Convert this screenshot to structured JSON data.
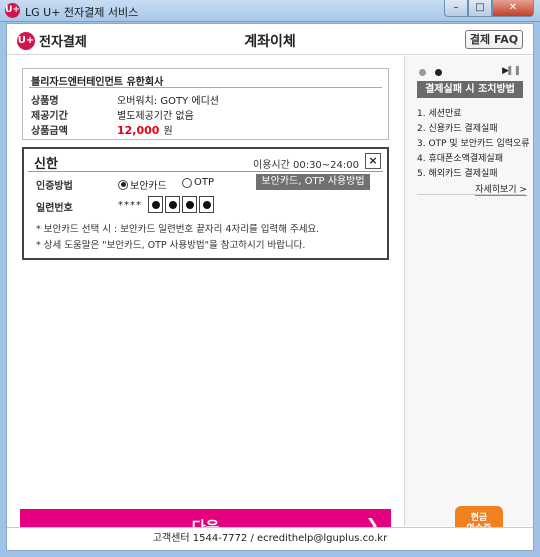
{
  "window": {
    "title": "LG U+ 전자결제 서비스",
    "icon_text": "U+"
  },
  "header": {
    "logo_text": "U+",
    "brand": "전자결제",
    "page_title": "계좌이체",
    "faq_button": "결제 FAQ"
  },
  "product": {
    "company": "블리자드엔터테인먼트 유한회사",
    "rows": [
      {
        "label": "상품명",
        "value": "오버워치: GOTY 에디션"
      },
      {
        "label": "제공기간",
        "value": "별도제공기간 없음"
      },
      {
        "label": "상품금액",
        "value": "12,000",
        "unit": "원"
      }
    ]
  },
  "bank": {
    "name": "신한",
    "hours": "이용시간 00:30~24:00",
    "close_icon": "×",
    "auth_label": "인증방법",
    "options": [
      {
        "label": "보안카드",
        "selected": true
      },
      {
        "label": "OTP",
        "selected": false
      }
    ],
    "help_badge": "보안카드, OTP 사용방법",
    "serial_label": "일련번호",
    "serial_mask": "****",
    "notices": [
      "* 보안카드 선택 시 : 보안카드 일련번호 끝자리 4자리를 입력해 주세요.",
      "* 상세 도움말은 \"보안카드, OTP 사용방법\"을 참고하시기 바랍니다."
    ]
  },
  "next_button": {
    "label": "다음",
    "chevron": "❯"
  },
  "sidebar": {
    "play_icon": "▶",
    "pause_icon": "❚❚",
    "title": "결제실패 시 조치방법",
    "items": [
      "1. 세션만료",
      "2. 신용카드 결제실패",
      "3. OTP 및 보안카드 입력오류",
      "4. 휴대폰소액결제실패",
      "5. 해외카드 결제실패"
    ],
    "more_link": "자세히보기 >",
    "receipt_button": [
      "현금",
      "영수증"
    ]
  },
  "footer": {
    "text": "고객센터 1544-7772 / ecredithelp@lguplus.co.kr"
  },
  "colors": {
    "brand_magenta": "#e5007f",
    "price_red": "#e60012",
    "logo": "#d0164e",
    "receipt_orange": "#f08020"
  }
}
